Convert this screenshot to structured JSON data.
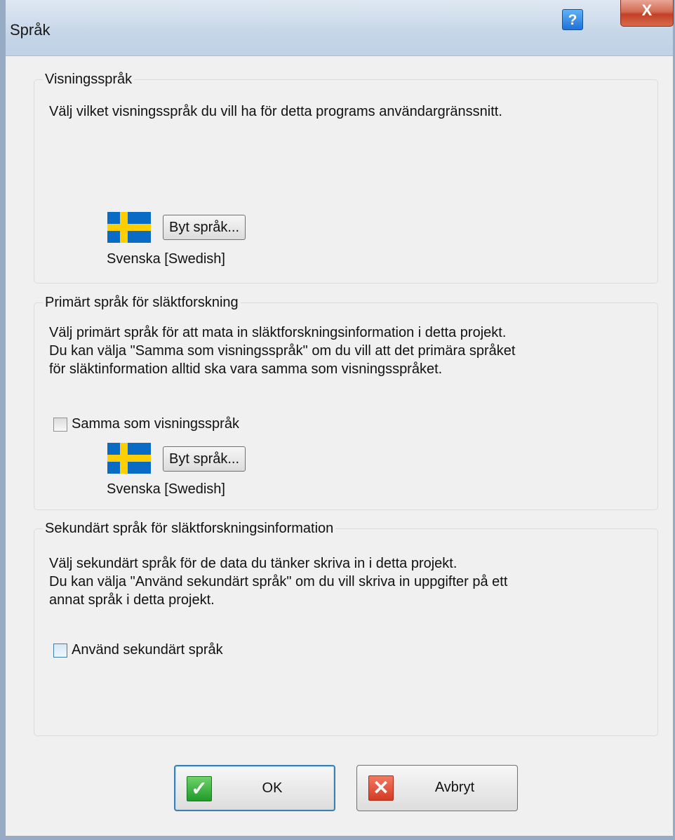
{
  "window": {
    "title": "Språk",
    "help_glyph": "?",
    "close_glyph": "X"
  },
  "display_language": {
    "legend": "Visningsspråk",
    "description": "Välj vilket visningsspråk du vill ha för detta programs användargränssnitt.",
    "flag_icon": "swedish-flag-icon",
    "change_button": "Byt språk...",
    "current_language": "Svenska [Swedish]"
  },
  "primary_language": {
    "legend": "Primärt språk för släktforskning",
    "description_lines": [
      "Välj primärt språk för att mata in släktforskningsinformation i detta projekt.",
      "Du kan välja \"Samma som visningsspråk\" om du vill att det primära språket",
      "för släktinformation alltid ska vara samma som visningsspråket."
    ],
    "checkbox_label": "Samma som visningsspråk",
    "checkbox_checked": false,
    "flag_icon": "swedish-flag-icon",
    "change_button": "Byt språk...",
    "current_language": "Svenska [Swedish]"
  },
  "secondary_language": {
    "legend": "Sekundärt språk för släktforskningsinformation",
    "description_lines": [
      "Välj sekundärt språk för de data du tänker skriva in i detta projekt.",
      "Du kan välja \"Använd sekundärt språk\" om du vill skriva in uppgifter på ett",
      "annat språk i detta projekt."
    ],
    "checkbox_label": "Använd sekundärt språk",
    "checkbox_checked": false
  },
  "footer": {
    "ok_label": "OK",
    "ok_glyph": "✓",
    "cancel_label": "Avbryt",
    "cancel_glyph": "✕"
  },
  "colors": {
    "flag_blue": "#0a6bc4",
    "flag_yellow": "#ffce00",
    "ok_green": "#1f9b28",
    "cancel_red": "#d53a22"
  }
}
